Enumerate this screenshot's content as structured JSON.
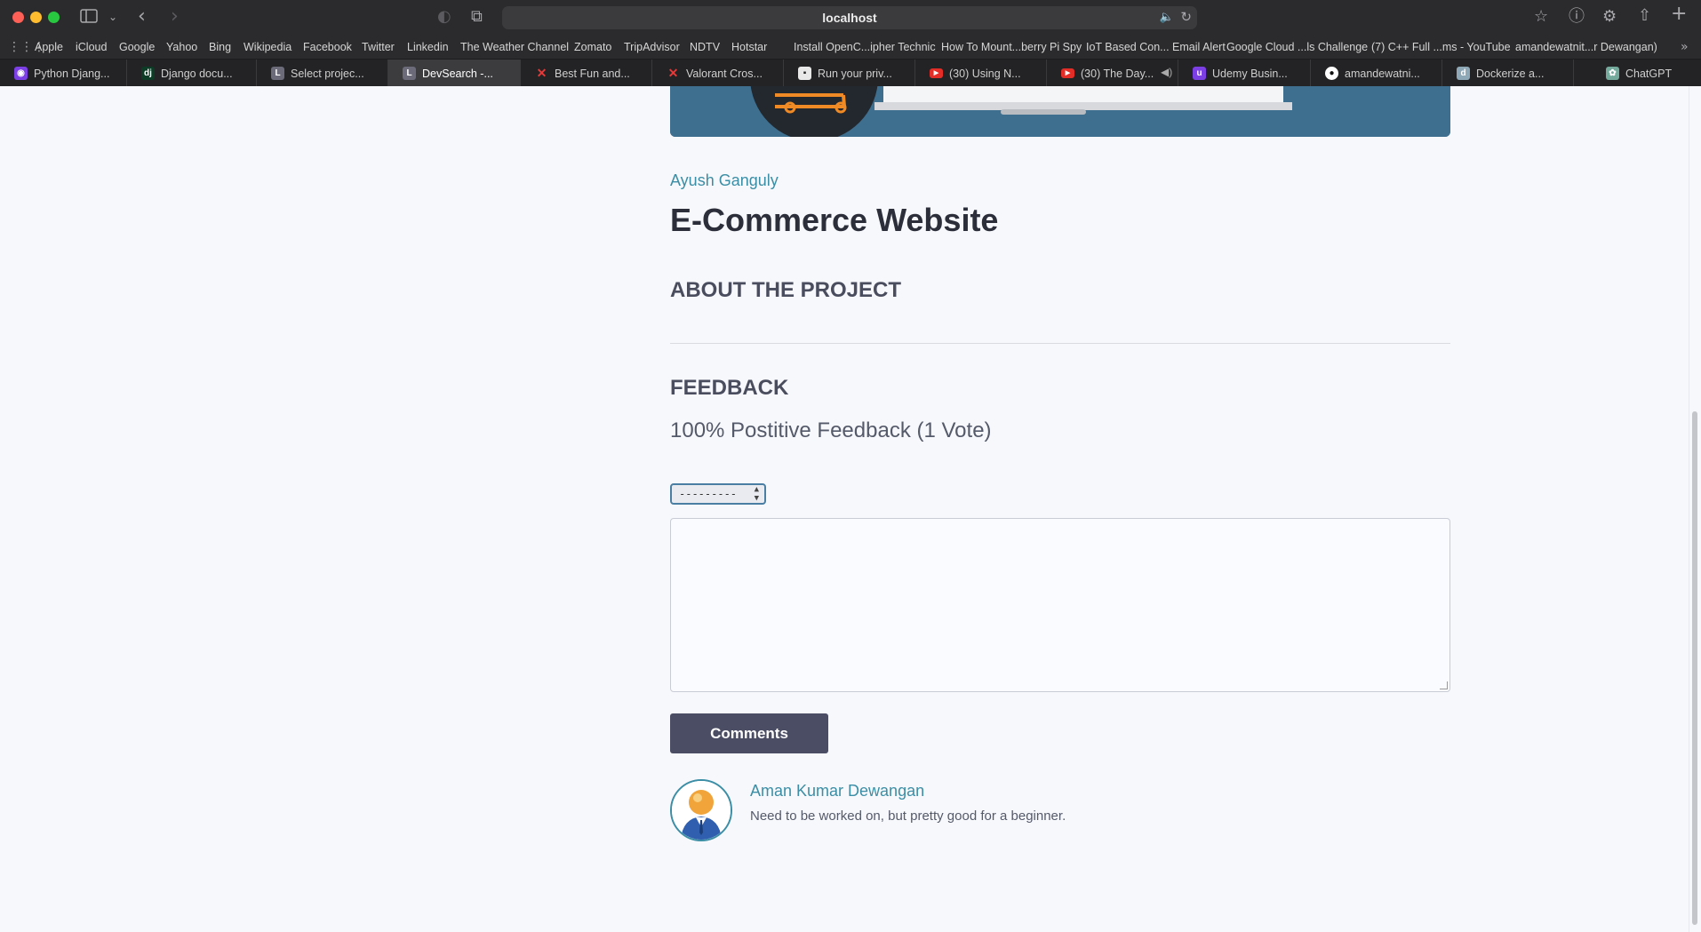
{
  "browser": {
    "url": "localhost",
    "bookmarks": [
      "Apple",
      "iCloud",
      "Google",
      "Yahoo",
      "Bing",
      "Wikipedia",
      "Facebook",
      "Twitter",
      "Linkedin",
      "The Weather Channel",
      "Zomato",
      "TripAdvisor",
      "NDTV",
      "Hotstar",
      "Install OpenC...ipher Technic",
      "How To Mount...berry Pi Spy",
      "IoT Based Con... Email Alert",
      "Google Cloud ...ls Challenge",
      "(7) C++ Full ...ms - YouTube",
      "amandewatnit...r Dewangan)"
    ],
    "tabs": [
      {
        "label": "Python Djang...",
        "icon": "p",
        "color": "#7b3fe4"
      },
      {
        "label": "Django docu...",
        "icon": "dj",
        "color": "#0c3c26"
      },
      {
        "label": "Select projec...",
        "icon": "L",
        "color": "#6b6b7a"
      },
      {
        "label": "DevSearch -...",
        "icon": "L",
        "color": "#6b6b7a"
      },
      {
        "label": "Best Fun and...",
        "icon": "x",
        "color": "#e23b3b"
      },
      {
        "label": "Valorant Cros...",
        "icon": "x",
        "color": "#e23b3b"
      },
      {
        "label": "Run your priv...",
        "icon": "r",
        "color": "#444"
      },
      {
        "label": "(30) Using N...",
        "icon": "yt",
        "color": "#e52d27"
      },
      {
        "label": "(30) The Day...",
        "icon": "yt",
        "color": "#e52d27"
      },
      {
        "label": "Udemy Busin...",
        "icon": "u",
        "color": "#7b3fe4"
      },
      {
        "label": "amandewatni...",
        "icon": "gh",
        "color": "#ffffff"
      },
      {
        "label": "Dockerize a...",
        "icon": "d",
        "color": "#8fa8b8"
      },
      {
        "label": "ChatGPT",
        "icon": "g",
        "color": "#74aa9c"
      }
    ],
    "active_tab": 3
  },
  "project": {
    "author": "Ayush Ganguly",
    "title": "E-Commerce Website",
    "about_heading": "ABOUT THE PROJECT"
  },
  "feedback": {
    "heading": "FEEDBACK",
    "summary": "100% Postitive Feedback (1 Vote)",
    "vote_select_value": "---------",
    "button_label": "Comments"
  },
  "comments": [
    {
      "name": "Aman Kumar Dewangan",
      "text": "Need to be worked on, but pretty good for a beginner."
    }
  ]
}
